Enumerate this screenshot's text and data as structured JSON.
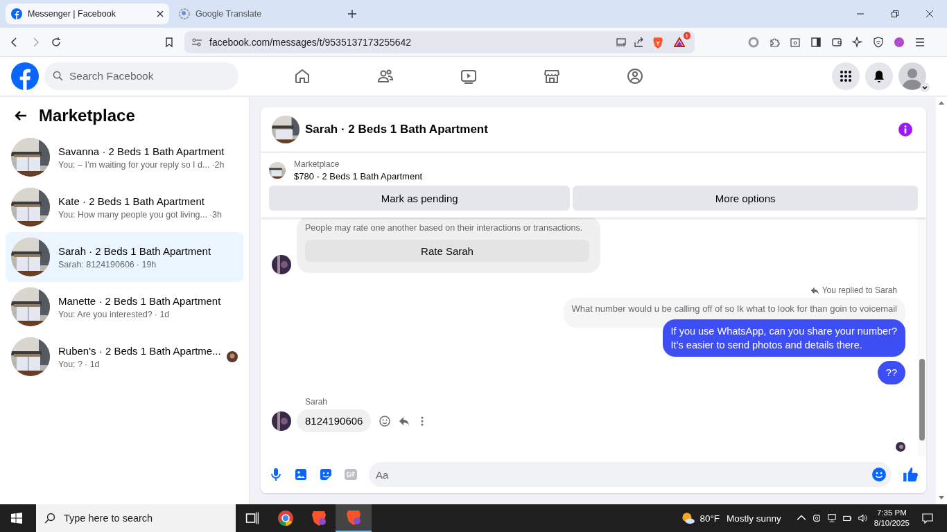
{
  "browser": {
    "tabs": [
      {
        "kind": "facebook",
        "title": "Messenger | Facebook",
        "selected": true
      },
      {
        "kind": "translate",
        "title": "Google Translate",
        "selected": false
      }
    ],
    "url": "facebook.com/messages/t/9535137173255642",
    "alert_count": "1"
  },
  "header": {
    "search_placeholder": "Search Facebook"
  },
  "sidebar": {
    "title": "Marketplace",
    "conversations": [
      {
        "name": "Savanna · 2 Beds 1 Bath Apartment",
        "preview": "You: – I’m waiting for your reply so I d...",
        "time": "·2h",
        "selected": false,
        "seen": false
      },
      {
        "name": "Kate · 2 Beds 1 Bath Apartment",
        "preview": "You: How many people you got living...",
        "time": "·3h",
        "selected": false,
        "seen": false
      },
      {
        "name": "Sarah · 2 Beds 1 Bath Apartment",
        "preview": "Sarah: 8124190606",
        "time": "· 19h",
        "selected": true,
        "seen": false
      },
      {
        "name": "Manette · 2 Beds 1 Bath Apartment",
        "preview": "You: Are you interested?",
        "time": "· 1d",
        "selected": false,
        "seen": false
      },
      {
        "name": "Ruben's · 2 Beds 1 Bath Apartme...",
        "preview": "You: ?",
        "time": "· 1d",
        "selected": false,
        "seen": true
      }
    ]
  },
  "chat": {
    "title": "Sarah · 2 Beds 1 Bath Apartment",
    "listing": {
      "label": "Marketplace",
      "title": "$780 - 2 Beds 1 Bath Apartment"
    },
    "actions": [
      "Mark as pending",
      "More options"
    ],
    "rating": {
      "text": "People may rate one another based on their interactions or transactions.",
      "button": "Rate Sarah"
    },
    "messages": [
      {
        "kind": "reply_note",
        "text": "You replied to Sarah"
      },
      {
        "kind": "quoted",
        "text": "What number would u be calling off of so Ik what to look for than goin to voicemail"
      },
      {
        "kind": "outgoing",
        "text": "If you use WhatsApp, can you share your number?\nIt’s easier to send photos and details there."
      },
      {
        "kind": "outgoing",
        "text": "??"
      },
      {
        "kind": "sender",
        "text": "Sarah"
      },
      {
        "kind": "incoming",
        "text": "8124190606"
      }
    ],
    "composer_placeholder": "Aa"
  },
  "taskbar": {
    "search_placeholder": "Type here to search",
    "temperature": "80°F",
    "weather": "Mostly sunny",
    "time": "7:35 PM",
    "date": "8/10/2025"
  }
}
